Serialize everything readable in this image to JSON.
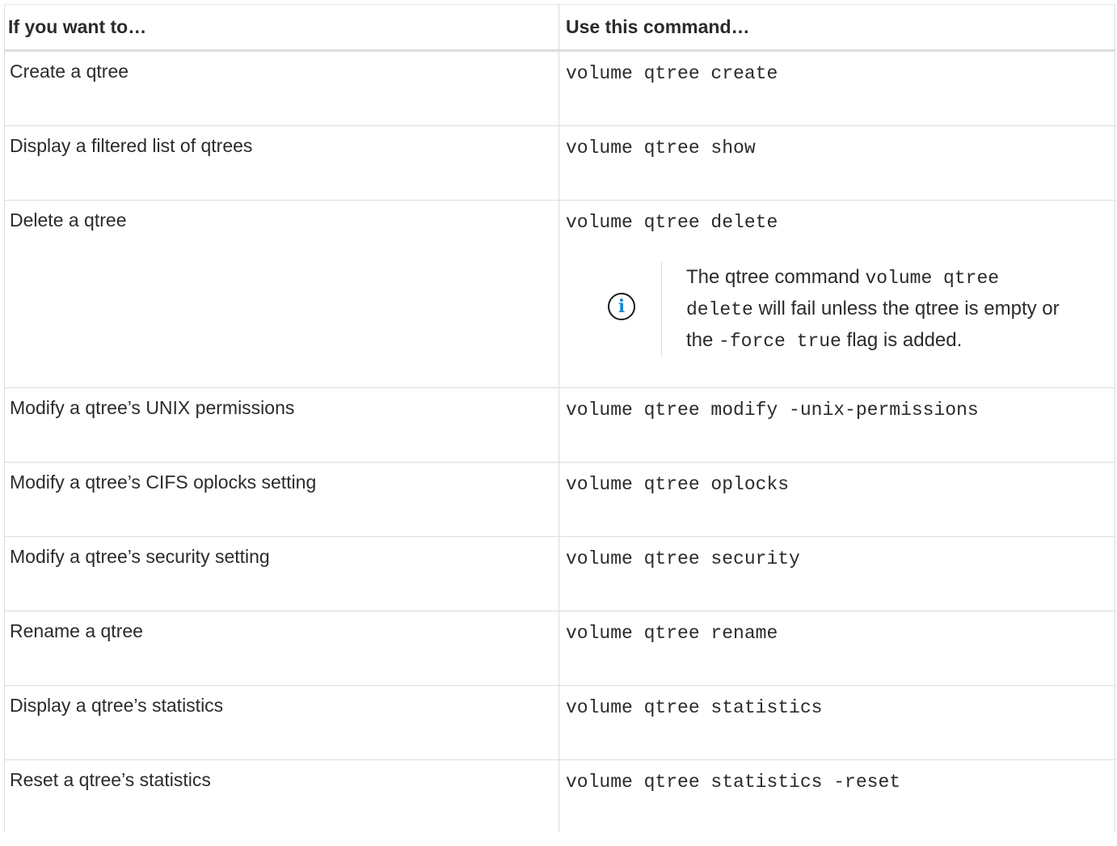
{
  "table": {
    "headers": {
      "col1": "If you want to…",
      "col2": "Use this command…"
    },
    "rows": [
      {
        "description": "Create a qtree",
        "command": "volume qtree create"
      },
      {
        "description": "Display a filtered list of qtrees",
        "command": "volume qtree show"
      },
      {
        "description": "Delete a qtree",
        "command": "volume qtree delete",
        "note": {
          "icon": "info-icon",
          "text_1": "The qtree command ",
          "code_1": "volume qtree delete",
          "text_2": " will fail unless the qtree is empty or the ",
          "code_2": "-force true",
          "text_3": " flag is added."
        }
      },
      {
        "description": "Modify a qtree’s UNIX permissions",
        "command": "volume qtree modify -unix-permissions"
      },
      {
        "description": "Modify a qtree’s CIFS oplocks setting",
        "command": "volume qtree oplocks"
      },
      {
        "description": "Modify a qtree’s security setting",
        "command": "volume qtree security"
      },
      {
        "description": "Rename a qtree",
        "command": "volume qtree rename"
      },
      {
        "description": "Display a qtree’s statistics",
        "command": "volume qtree statistics"
      },
      {
        "description": "Reset a qtree’s statistics",
        "command": "volume qtree statistics -reset"
      }
    ]
  },
  "colors": {
    "text": "#2b2b2b",
    "border": "#dcdcdc",
    "info_accent": "#1a8ad6"
  }
}
